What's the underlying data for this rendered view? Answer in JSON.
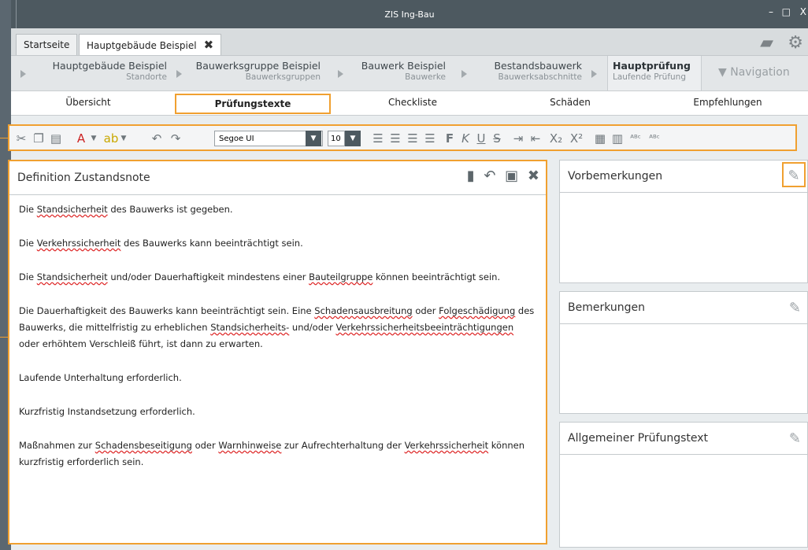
{
  "window": {
    "title": "ZIS Ing-Bau",
    "minimize": "–",
    "maximize": "□",
    "close": "X"
  },
  "tabs": [
    {
      "label": "Startseite"
    },
    {
      "label": "Hauptgebäude Beispiel",
      "close": "✖"
    }
  ],
  "breadcrumbs": [
    {
      "title": "Hauptgebäude Beispiel",
      "sub": "Standorte"
    },
    {
      "title": "Bauwerksgruppe Beispiel",
      "sub": "Bauwerksgruppen"
    },
    {
      "title": "Bauwerk Beispiel",
      "sub": "Bauwerke"
    },
    {
      "title": "Bestandsbauwerk",
      "sub": "Bauwerksabschnitte"
    },
    {
      "title": "Hauptprüfung",
      "sub": "Laufende Prüfung"
    }
  ],
  "navigation": {
    "label": "▼ Navigation"
  },
  "subtabs": [
    "Übersicht",
    "Prüfungstexte",
    "Checkliste",
    "Schäden",
    "Empfehlungen"
  ],
  "toolbar": {
    "font": "Segoe UI",
    "size": "10",
    "bold": "F",
    "italic": "K",
    "underline": "U",
    "strike": "S",
    "subscript": "X₂",
    "superscript": "X²"
  },
  "main_panel": {
    "title": "Definition Zustandsnote",
    "paragraphs": [
      "Die Standsicherheit des Bauwerks ist gegeben.",
      "Die Verkehrssicherheit des Bauwerks kann beeinträchtigt sein.",
      "Die Standsicherheit und/oder Dauerhaftigkeit mindestens einer Bauteilgruppe können beeinträchtigt sein.",
      "Die Dauerhaftigkeit des Bauwerks kann beeinträchtigt sein. Eine Schadensausbreitung oder Folgeschädigung des Bauwerks, die mittelfristig zu erheblichen Standsicherheits- und/oder Verkehrssicherheitsbeeinträchtigungen oder erhöhtem Verschleiß führt, ist dann zu erwarten.",
      "Laufende Unterhaltung erforderlich.",
      "Kurzfristig Instandsetzung erforderlich.",
      "Maßnahmen zur Schadensbeseitigung oder Warnhinweise zur Aufrechterhaltung der Verkehrssicherheit können kurzfristig erforderlich sein."
    ]
  },
  "side_panels": [
    {
      "title": "Vorbemerkungen"
    },
    {
      "title": "Bemerkungen"
    },
    {
      "title": "Allgemeiner Prüfungstext"
    }
  ],
  "colors": {
    "accent": "#f0a030",
    "titlebar": "#4d5960",
    "spellcheck": "#d22222"
  }
}
